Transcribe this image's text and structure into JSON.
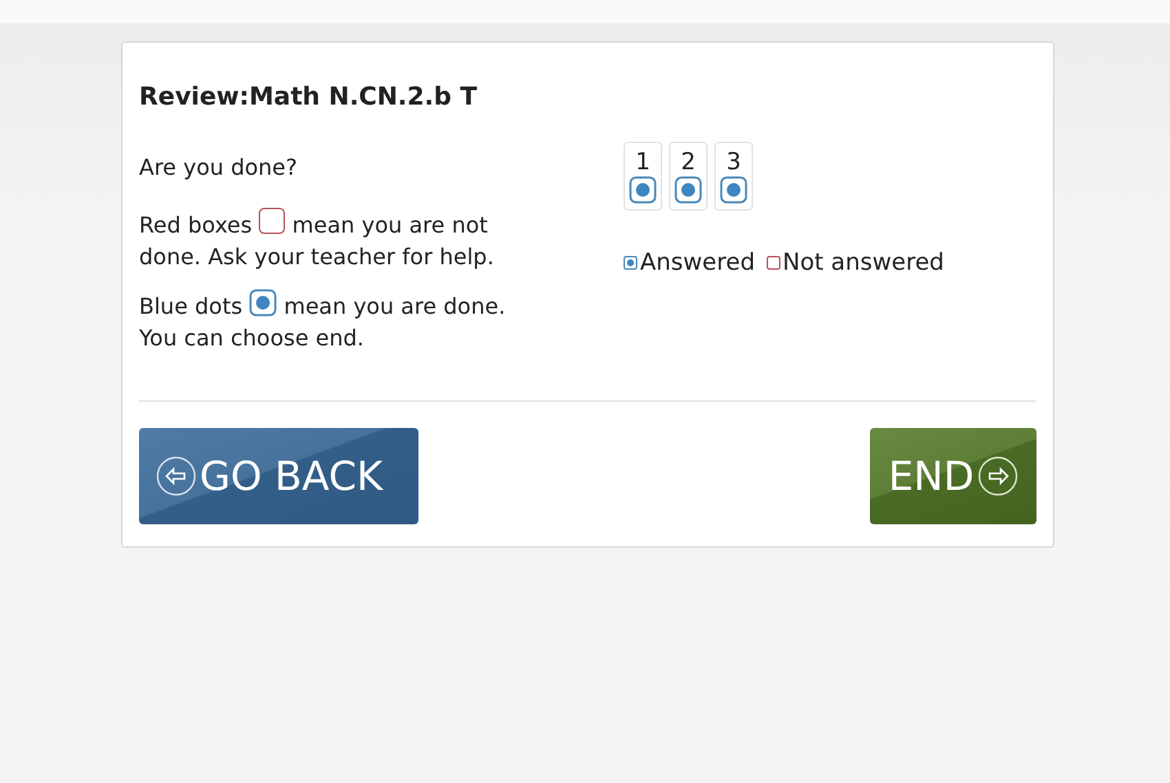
{
  "title": "Review:Math N.CN.2.b T",
  "prompt": "Are you done?",
  "red_note": {
    "before": "Red boxes",
    "after": "mean you are not",
    "line2": "done. Ask your teacher for help."
  },
  "blue_note": {
    "before": "Blue dots",
    "after": "mean you are done.",
    "line2": "You can choose end."
  },
  "questions": [
    {
      "number": "1",
      "answered": true
    },
    {
      "number": "2",
      "answered": true
    },
    {
      "number": "3",
      "answered": true
    }
  ],
  "legend": {
    "answered": "Answered",
    "not_answered": "Not answered"
  },
  "buttons": {
    "back": "GO BACK",
    "end": "END"
  }
}
